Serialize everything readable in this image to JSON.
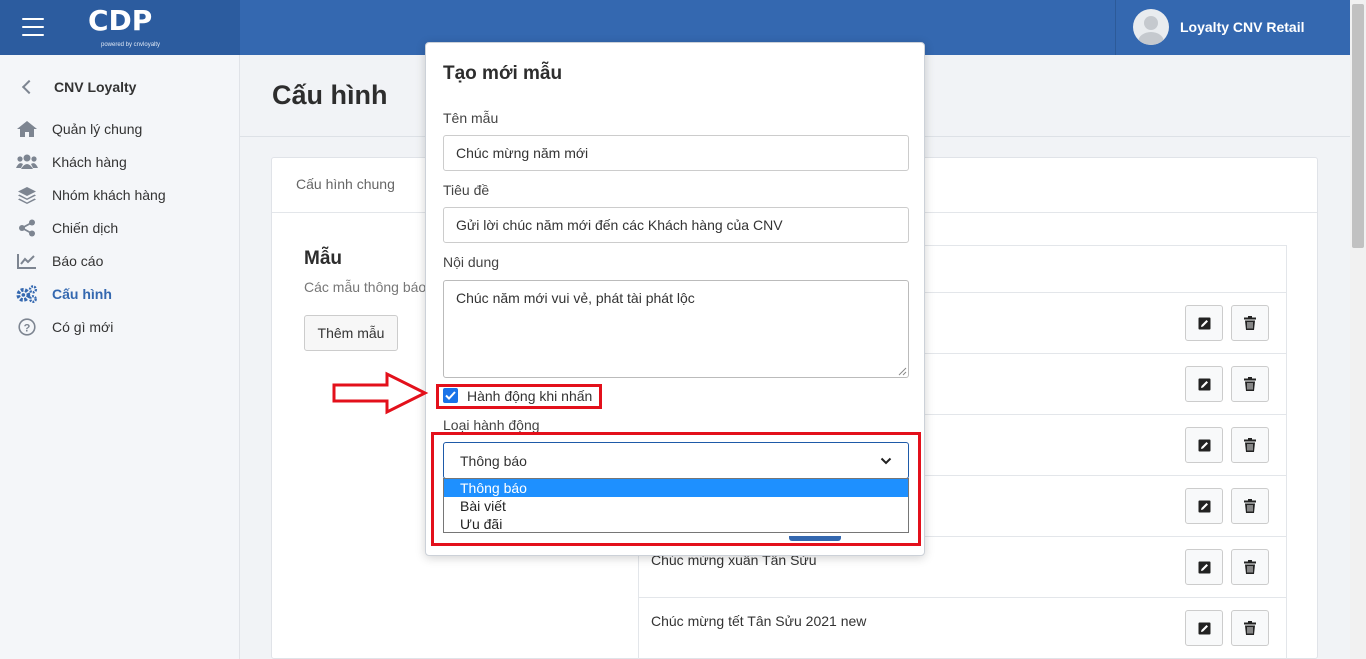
{
  "app": {
    "logo": "CDP",
    "logo_sub": "powered by cnvloyalty",
    "user_name": "Loyalty CNV Retail"
  },
  "sidebar": {
    "back_label": "CNV Loyalty",
    "items": [
      {
        "label": "Quản lý chung",
        "icon": "home-icon"
      },
      {
        "label": "Khách hàng",
        "icon": "users-icon"
      },
      {
        "label": "Nhóm khách hàng",
        "icon": "layers-icon"
      },
      {
        "label": "Chiến dịch",
        "icon": "share-icon"
      },
      {
        "label": "Báo cáo",
        "icon": "chart-line-icon"
      },
      {
        "label": "Cấu hình",
        "icon": "gears-icon",
        "active": true
      },
      {
        "label": "Có gì mới",
        "icon": "question-circle-icon"
      }
    ]
  },
  "main": {
    "title": "Cấu hình",
    "tab": "Cấu hình chung",
    "section_title": "Mẫu",
    "section_sub": "Các mẫu thông báo",
    "add_button": "Thêm mẫu",
    "rows": [
      {
        "name": ""
      },
      {
        "name": ""
      },
      {
        "name": ""
      },
      {
        "name": ""
      },
      {
        "name": "Chúc mừng xuân Tân Sửu"
      },
      {
        "name": "Chúc mừng tết Tân Sửu 2021 new"
      }
    ]
  },
  "modal": {
    "title": "Tạo mới mẫu",
    "name_label": "Tên mẫu",
    "name_value": "Chúc mừng năm mới",
    "subject_label": "Tiêu đề",
    "subject_value": "Gửi lời chúc năm mới đến các Khách hàng của CNV",
    "content_label": "Nội dung",
    "content_value": "Chúc năm mới vui vẻ, phát tài phát lộc",
    "checkbox_label": "Hành động khi nhấn",
    "checkbox_checked": true,
    "action_type_label": "Loại hành động",
    "action_type_selected": "Thông báo",
    "action_type_options": [
      "Thông báo",
      "Bài viết",
      "Ưu đãi"
    ]
  },
  "colors": {
    "header": "#3468b0",
    "accent": "#3468b0",
    "highlight": "#e3101b",
    "option_selected": "#1e90ff"
  }
}
